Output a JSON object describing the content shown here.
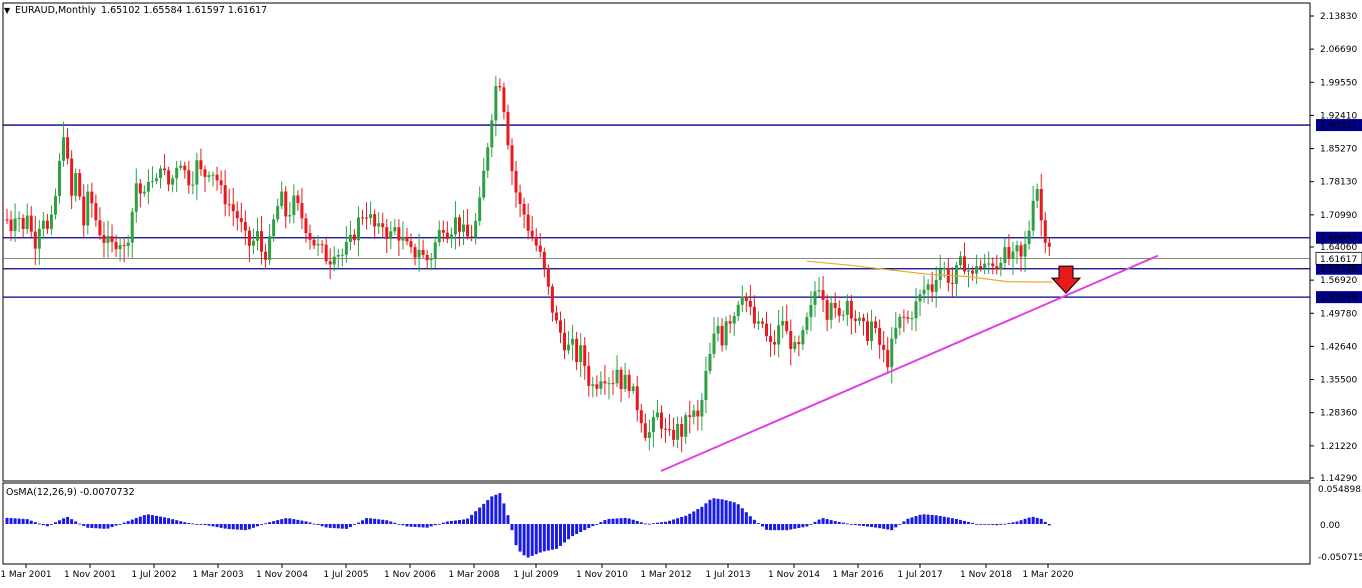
{
  "header": {
    "arrow_glyph": "▼",
    "symbol": "EURAUD,Monthly",
    "ohlc": "1.65102 1.65584 1.61597 1.61617"
  },
  "indicator": {
    "label": "OsMA(12,26,9) -0.0070732",
    "top_label": "0.0548983",
    "zero_label": "0.00",
    "bottom_label": "-0.050715"
  },
  "colors": {
    "background": "#ffffff",
    "bull_candle": "#2ea043",
    "bear_candle": "#e8191c",
    "hline": "#00008b",
    "trendline": "#e040e0",
    "moving_average": "#f0a830",
    "osma_bar": "#1a1ae6",
    "price_tag_bg": "#00008b",
    "current_tag_bg": "#ffffff",
    "signal_arrow": "#e8191c"
  },
  "chart_data": {
    "type": "candlestick",
    "symbol": "EURAUD",
    "timeframe": "Monthly",
    "y_ticks": [
      "2.13830",
      "2.06690",
      "1.99550",
      "1.92410",
      "1.85270",
      "1.78130",
      "1.70990",
      "1.64060",
      "1.56920",
      "1.49780",
      "1.42640",
      "1.35500",
      "1.28360",
      "1.21220",
      "1.14290"
    ],
    "x_ticks": [
      "1 Mar 2001",
      "1 Nov 2001",
      "1 Jul 2002",
      "1 Mar 2003",
      "1 Nov 2004",
      "1 Jul 2005",
      "1 Nov 2006",
      "1 Mar 2008",
      "1 Jul 2009",
      "1 Nov 2010",
      "1 Mar 2012",
      "1 Jul 2013",
      "1 Nov 2014",
      "1 Mar 2016",
      "1 Jul 2017",
      "1 Nov 2018",
      "1 Mar 2020"
    ],
    "ylim": [
      1.1429,
      2.1383
    ],
    "horizontal_levels": [
      "1.90331",
      "1.66057",
      "1.59376",
      "1.53259"
    ],
    "current_price": "1.61617",
    "price_path": [
      [
        0,
        1.7
      ],
      [
        5,
        1.68
      ],
      [
        10,
        1.74
      ],
      [
        15,
        1.66
      ],
      [
        20,
        1.72
      ],
      [
        27,
        1.64
      ],
      [
        35,
        1.72
      ],
      [
        42,
        1.66
      ],
      [
        50,
        1.77
      ],
      [
        57,
        1.9
      ],
      [
        64,
        1.74
      ],
      [
        70,
        1.81
      ],
      [
        76,
        1.68
      ],
      [
        82,
        1.76
      ],
      [
        90,
        1.69
      ],
      [
        96,
        1.66
      ],
      [
        104,
        1.64
      ],
      [
        112,
        1.66
      ],
      [
        118,
        1.63
      ],
      [
        124,
        1.7
      ],
      [
        130,
        1.79
      ],
      [
        136,
        1.73
      ],
      [
        142,
        1.8
      ],
      [
        148,
        1.76
      ],
      [
        154,
        1.83
      ],
      [
        160,
        1.77
      ],
      [
        166,
        1.79
      ],
      [
        172,
        1.84
      ],
      [
        178,
        1.8
      ],
      [
        184,
        1.78
      ],
      [
        190,
        1.82
      ],
      [
        196,
        1.79
      ],
      [
        202,
        1.81
      ],
      [
        208,
        1.8
      ],
      [
        214,
        1.76
      ],
      [
        220,
        1.74
      ],
      [
        226,
        1.72
      ],
      [
        232,
        1.7
      ],
      [
        238,
        1.66
      ],
      [
        244,
        1.64
      ],
      [
        250,
        1.67
      ],
      [
        256,
        1.62
      ],
      [
        262,
        1.64
      ],
      [
        268,
        1.71
      ],
      [
        274,
        1.75
      ],
      [
        280,
        1.7
      ],
      [
        286,
        1.74
      ],
      [
        292,
        1.72
      ],
      [
        298,
        1.69
      ],
      [
        304,
        1.66
      ],
      [
        310,
        1.64
      ],
      [
        316,
        1.63
      ],
      [
        322,
        1.61
      ],
      [
        328,
        1.64
      ],
      [
        334,
        1.62
      ],
      [
        340,
        1.64
      ],
      [
        346,
        1.66
      ],
      [
        352,
        1.7
      ],
      [
        358,
        1.72
      ],
      [
        364,
        1.7
      ],
      [
        370,
        1.67
      ],
      [
        376,
        1.69
      ],
      [
        382,
        1.66
      ],
      [
        388,
        1.68
      ],
      [
        394,
        1.66
      ],
      [
        400,
        1.64
      ],
      [
        406,
        1.62
      ],
      [
        412,
        1.64
      ],
      [
        418,
        1.61
      ],
      [
        424,
        1.62
      ],
      [
        430,
        1.66
      ],
      [
        436,
        1.69
      ],
      [
        442,
        1.67
      ],
      [
        448,
        1.7
      ],
      [
        454,
        1.68
      ],
      [
        460,
        1.66
      ],
      [
        466,
        1.67
      ],
      [
        472,
        1.72
      ],
      [
        478,
        1.82
      ],
      [
        483,
        1.9
      ],
      [
        488,
        1.98
      ],
      [
        492,
        2.01
      ],
      [
        496,
        1.96
      ],
      [
        500,
        1.89
      ],
      [
        504,
        1.82
      ],
      [
        508,
        1.77
      ],
      [
        512,
        1.73
      ],
      [
        516,
        1.72
      ],
      [
        520,
        1.69
      ],
      [
        524,
        1.67
      ],
      [
        528,
        1.65
      ],
      [
        532,
        1.63
      ],
      [
        536,
        1.6
      ],
      [
        540,
        1.56
      ],
      [
        545,
        1.51
      ],
      [
        550,
        1.47
      ],
      [
        555,
        1.45
      ],
      [
        560,
        1.42
      ],
      [
        565,
        1.43
      ],
      [
        570,
        1.4
      ],
      [
        575,
        1.42
      ],
      [
        580,
        1.36
      ],
      [
        585,
        1.34
      ],
      [
        590,
        1.35
      ],
      [
        595,
        1.37
      ],
      [
        600,
        1.36
      ],
      [
        605,
        1.35
      ],
      [
        610,
        1.38
      ],
      [
        615,
        1.34
      ],
      [
        620,
        1.36
      ],
      [
        625,
        1.33
      ],
      [
        630,
        1.3
      ],
      [
        635,
        1.27
      ],
      [
        640,
        1.23
      ],
      [
        645,
        1.25
      ],
      [
        650,
        1.28
      ],
      [
        655,
        1.26
      ],
      [
        660,
        1.23
      ],
      [
        665,
        1.23
      ],
      [
        670,
        1.25
      ],
      [
        675,
        1.24
      ],
      [
        680,
        1.27
      ],
      [
        685,
        1.29
      ],
      [
        690,
        1.26
      ],
      [
        695,
        1.31
      ],
      [
        700,
        1.38
      ],
      [
        705,
        1.42
      ],
      [
        710,
        1.48
      ],
      [
        715,
        1.44
      ],
      [
        720,
        1.5
      ],
      [
        725,
        1.48
      ],
      [
        730,
        1.52
      ],
      [
        735,
        1.55
      ],
      [
        740,
        1.52
      ],
      [
        745,
        1.49
      ],
      [
        750,
        1.46
      ],
      [
        755,
        1.48
      ],
      [
        760,
        1.44
      ],
      [
        765,
        1.42
      ],
      [
        770,
        1.45
      ],
      [
        775,
        1.49
      ],
      [
        780,
        1.45
      ],
      [
        785,
        1.43
      ],
      [
        790,
        1.41
      ],
      [
        795,
        1.44
      ],
      [
        800,
        1.48
      ],
      [
        805,
        1.51
      ],
      [
        810,
        1.57
      ],
      [
        815,
        1.55
      ],
      [
        820,
        1.5
      ],
      [
        825,
        1.54
      ],
      [
        830,
        1.47
      ],
      [
        835,
        1.5
      ],
      [
        840,
        1.53
      ],
      [
        845,
        1.5
      ],
      [
        850,
        1.48
      ],
      [
        855,
        1.47
      ],
      [
        860,
        1.45
      ],
      [
        865,
        1.48
      ],
      [
        870,
        1.44
      ],
      [
        875,
        1.42
      ],
      [
        880,
        1.39
      ],
      [
        885,
        1.43
      ],
      [
        890,
        1.47
      ],
      [
        895,
        1.49
      ],
      [
        900,
        1.48
      ],
      [
        905,
        1.5
      ],
      [
        910,
        1.52
      ],
      [
        915,
        1.54
      ],
      [
        920,
        1.56
      ],
      [
        925,
        1.55
      ],
      [
        930,
        1.59
      ],
      [
        935,
        1.6
      ],
      [
        940,
        1.58
      ],
      [
        945,
        1.56
      ],
      [
        950,
        1.59
      ],
      [
        955,
        1.61
      ],
      [
        960,
        1.6
      ],
      [
        965,
        1.57
      ],
      [
        970,
        1.61
      ],
      [
        975,
        1.59
      ],
      [
        980,
        1.6
      ],
      [
        985,
        1.61
      ],
      [
        990,
        1.6
      ],
      [
        995,
        1.63
      ],
      [
        1000,
        1.62
      ],
      [
        1005,
        1.61
      ],
      [
        1010,
        1.63
      ],
      [
        1015,
        1.61
      ],
      [
        1020,
        1.66
      ],
      [
        1024,
        1.7
      ],
      [
        1028,
        1.8
      ],
      [
        1031,
        1.76
      ],
      [
        1034,
        1.7
      ],
      [
        1037,
        1.67
      ],
      [
        1041,
        1.66
      ],
      [
        1045,
        1.63
      ]
    ],
    "moving_average_path": [
      [
        800,
        1.61
      ],
      [
        840,
        1.602
      ],
      [
        880,
        1.592
      ],
      [
        920,
        1.582
      ],
      [
        960,
        1.577
      ],
      [
        1000,
        1.566
      ],
      [
        1045,
        1.565
      ]
    ],
    "trendline": [
      [
        0,
        1.158
      ],
      [
        1,
        1.622
      ]
    ],
    "annotations": [
      "down arrow near 1.59376"
    ],
    "osma_path": [
      [
        0,
        0.01
      ],
      [
        20,
        0.008
      ],
      [
        40,
        -0.004
      ],
      [
        60,
        0.012
      ],
      [
        80,
        -0.006
      ],
      [
        100,
        -0.008
      ],
      [
        120,
        0.004
      ],
      [
        140,
        0.016
      ],
      [
        160,
        0.01
      ],
      [
        180,
        0.002
      ],
      [
        200,
        -0.002
      ],
      [
        220,
        -0.008
      ],
      [
        240,
        -0.01
      ],
      [
        260,
        0.002
      ],
      [
        280,
        0.01
      ],
      [
        300,
        0.004
      ],
      [
        320,
        -0.006
      ],
      [
        340,
        -0.008
      ],
      [
        360,
        0.01
      ],
      [
        380,
        0.006
      ],
      [
        400,
        -0.004
      ],
      [
        420,
        -0.006
      ],
      [
        440,
        0.004
      ],
      [
        460,
        0.008
      ],
      [
        475,
        0.03
      ],
      [
        485,
        0.045
      ],
      [
        493,
        0.05
      ],
      [
        500,
        0.02
      ],
      [
        510,
        -0.04
      ],
      [
        520,
        -0.055
      ],
      [
        535,
        -0.045
      ],
      [
        550,
        -0.04
      ],
      [
        565,
        -0.02
      ],
      [
        580,
        -0.008
      ],
      [
        600,
        0.008
      ],
      [
        620,
        0.01
      ],
      [
        640,
        0.0
      ],
      [
        660,
        0.004
      ],
      [
        680,
        0.014
      ],
      [
        695,
        0.028
      ],
      [
        705,
        0.042
      ],
      [
        715,
        0.04
      ],
      [
        730,
        0.034
      ],
      [
        745,
        0.01
      ],
      [
        760,
        -0.01
      ],
      [
        780,
        -0.01
      ],
      [
        800,
        -0.004
      ],
      [
        815,
        0.01
      ],
      [
        830,
        0.004
      ],
      [
        850,
        -0.002
      ],
      [
        870,
        -0.006
      ],
      [
        885,
        -0.01
      ],
      [
        900,
        0.008
      ],
      [
        915,
        0.016
      ],
      [
        930,
        0.014
      ],
      [
        950,
        0.008
      ],
      [
        970,
        0.0
      ],
      [
        990,
        -0.002
      ],
      [
        1010,
        0.004
      ],
      [
        1025,
        0.012
      ],
      [
        1035,
        0.008
      ],
      [
        1045,
        -0.006
      ]
    ]
  }
}
